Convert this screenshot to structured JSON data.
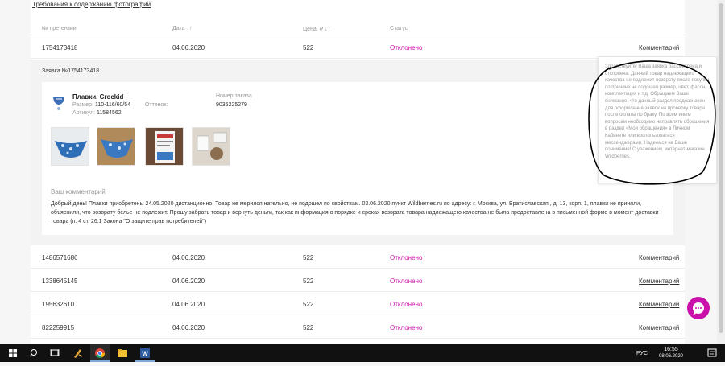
{
  "top_link": "Требования к содержанию фотографий",
  "table": {
    "headers": {
      "claim": "№ претензии",
      "date": "Дата ↓↑",
      "price": "Цена, ₽ ↓↑",
      "status": "Статус"
    },
    "first_row": {
      "id": "1754173418",
      "date": "04.06.2020",
      "price": "522",
      "status": "Отклонено",
      "comment": "Комментарий"
    },
    "rows": [
      {
        "id": "1486571686",
        "date": "04.06.2020",
        "price": "522",
        "status": "Отклонено",
        "comment": "Комментарий"
      },
      {
        "id": "1338645145",
        "date": "04.06.2020",
        "price": "522",
        "status": "Отклонено",
        "comment": "Комментарий"
      },
      {
        "id": "195632610",
        "date": "04.06.2020",
        "price": "522",
        "status": "Отклонено",
        "comment": "Комментарий"
      },
      {
        "id": "822259915",
        "date": "04.06.2020",
        "price": "522",
        "status": "Отклонено",
        "comment": "Комментарий"
      }
    ]
  },
  "detail": {
    "title": "Заявка №1754173418",
    "product": {
      "name": "Плавки, Crockid",
      "size_label": "Размер:",
      "size_value": "110-116/60/54",
      "article_label": "Артикул:",
      "article_value": "11584562",
      "shade_label": "Оттенок:",
      "order_label": "Номер заказа",
      "order_value": "9036225279"
    },
    "your_comment_label": "Ваш комментарий",
    "your_comment_text": "Добрый день! Плавки приобретены 24.05.2020 дистанционно. Товар не мерился нательно, не подошел по свойствам. 03.06.2020 пункт Wildberries.ru по адресу: г. Москва, ул. Братиславская , д. 13, корп. 1, плавки не приняли, объяснили, что возврату белье не подлежит. Прошу забрать товар и вернуть деньги, так как информация о порядке и сроках возврата товара надлежащего качества не была предоставлена в письменной форме в момент доставки товара (п. 4 ст. 26.1 Закона \"О защите прав потребителей\")"
  },
  "tooltip": {
    "text": "Здравствуйте! Ваша заявка рассмотрена и отклонена. Данный товар надлежащего качества не подлежит возврату после покупки по причине не подошел размер, цвет, фасон, комплектация и т.д. Обращаем Ваше внимание, что данный раздел предназначен для оформления заявок на проверку товара после оплаты по браку. По всем иным вопросам необходимо направлять обращения в раздел «Мои обращения» в Личном Кабинете или воспользоваться мессенджерами. Надеемся на Ваше понимание! С уважением, интернет-магазин Wildberries."
  },
  "taskbar": {
    "lang": "РУС",
    "time": "16:55",
    "date": "08.06.2020"
  },
  "colors": {
    "accent": "#cb11ab",
    "taskbar": "#111111"
  },
  "icons": [
    "windows-start-icon",
    "search-icon",
    "task-view-icon",
    "app-icon",
    "chrome-icon",
    "file-explorer-icon",
    "word-icon",
    "chat-icon"
  ]
}
